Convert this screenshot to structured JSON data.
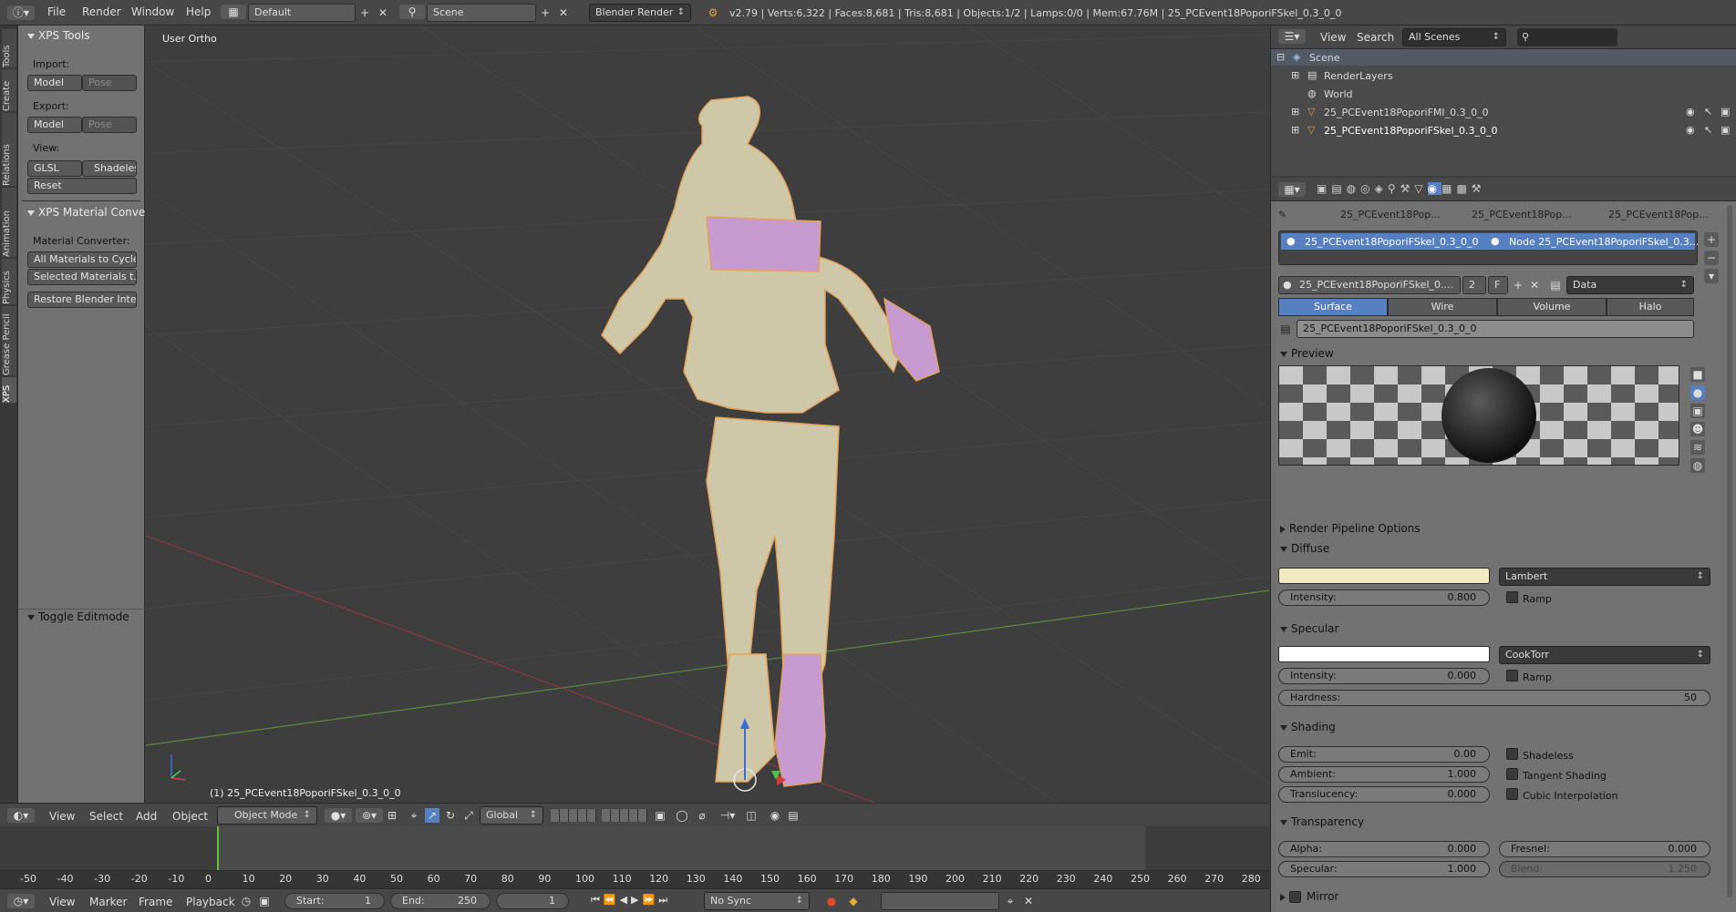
{
  "topbar": {
    "menus": [
      "File",
      "Render",
      "Window",
      "Help"
    ],
    "layout": "Default",
    "scene": "Scene",
    "engine": "Blender Render",
    "stats": "v2.79 | Verts:6,322 | Faces:8,681 | Tris:8,681 | Objects:1/2 | Lamps:0/0 | Mem:67.76M | 25_PCEvent18PoporiFSkel_0.3_0_0"
  },
  "toolshelf": {
    "tabs": [
      "Tools",
      "Create",
      "Relations",
      "Animation",
      "Physics",
      "Grease Pencil",
      "XPS"
    ],
    "panel_title": "XPS Tools",
    "import_label": "Import:",
    "import_buttons": [
      "Model",
      "Pose"
    ],
    "export_label": "Export:",
    "export_buttons": [
      "Model",
      "Pose"
    ],
    "view_label": "View:",
    "view_buttons": [
      "GLSL",
      "Shadeless"
    ],
    "reset": "Reset",
    "mat_panel_title": "XPS Material Conver",
    "mat_converter_label": "Material Converter:",
    "mat_buttons": [
      "All Materials to Cycles",
      "Selected Materials t...",
      "Restore Blender Inte..."
    ],
    "toggle_editmode": "Toggle Editmode"
  },
  "viewport": {
    "view_label": "User Ortho",
    "object_label": "(1) 25_PCEvent18PoporiFSkel_0.3_0_0",
    "header_menus": [
      "View",
      "Select",
      "Add",
      "Object"
    ],
    "mode": "Object Mode",
    "orientation": "Global"
  },
  "timeline": {
    "ticks": [
      "-50",
      "-40",
      "-30",
      "-20",
      "-10",
      "0",
      "10",
      "20",
      "30",
      "40",
      "50",
      "60",
      "70",
      "80",
      "90",
      "100",
      "110",
      "120",
      "130",
      "140",
      "150",
      "160",
      "170",
      "180",
      "190",
      "200",
      "210",
      "220",
      "230",
      "240",
      "250",
      "260",
      "270",
      "280"
    ],
    "menus": [
      "View",
      "Marker",
      "Frame",
      "Playback"
    ],
    "start_label": "Start:",
    "start": "1",
    "end_label": "End:",
    "end": "250",
    "current": "1",
    "sync": "No Sync"
  },
  "outliner": {
    "menus": [
      "View",
      "Search"
    ],
    "filter": "All Scenes",
    "items": [
      "Scene",
      "RenderLayers",
      "World",
      "25_PCEvent18PoporiFMI_0.3_0_0",
      "25_PCEvent18PoporiFSkel_0.3_0_0"
    ]
  },
  "properties": {
    "breadcrumb": [
      "25_PCEvent18Pop...",
      "25_PCEvent18Pop...",
      "25_PCEvent18Pop..."
    ],
    "slots": [
      "25_PCEvent18PoporiFSkel_0.3_0_0",
      "Node 25_PCEvent18PoporiFSkel_0.3..."
    ],
    "material_name": "25_PCEvent18PoporiFSkel_0....",
    "users": "2",
    "fake": "F",
    "link": "Data",
    "tabs": [
      "Surface",
      "Wire",
      "Volume",
      "Halo"
    ],
    "node_name": "25_PCEvent18PoporiFSkel_0.3_0_0",
    "preview_title": "Preview",
    "render_pipeline": "Render Pipeline Options",
    "diffuse": {
      "title": "Diffuse",
      "shader": "Lambert",
      "intensity_label": "Intensity:",
      "intensity": "0.800",
      "ramp": "Ramp",
      "color": "#f1e8c4"
    },
    "specular": {
      "title": "Specular",
      "shader": "CookTorr",
      "intensity_label": "Intensity:",
      "intensity": "0.000",
      "ramp": "Ramp",
      "hardness_label": "Hardness:",
      "hardness": "50",
      "color": "#ffffff"
    },
    "shading": {
      "title": "Shading",
      "emit_label": "Emit:",
      "emit": "0.00",
      "ambient_label": "Ambient:",
      "ambient": "1.000",
      "translucency_label": "Translucency:",
      "translucency": "0.000",
      "shadeless": "Shadeless",
      "tangent": "Tangent Shading",
      "cubic": "Cubic Interpolation"
    },
    "transparency": {
      "title": "Transparency",
      "alpha_label": "Alpha:",
      "alpha": "0.000",
      "spec_label": "Specular:",
      "spec": "1.000",
      "fresnel_label": "Fresnel:",
      "fresnel": "0.000",
      "blend_label": "Blend:",
      "blend": "1.250"
    },
    "mirror": "Mirror"
  }
}
